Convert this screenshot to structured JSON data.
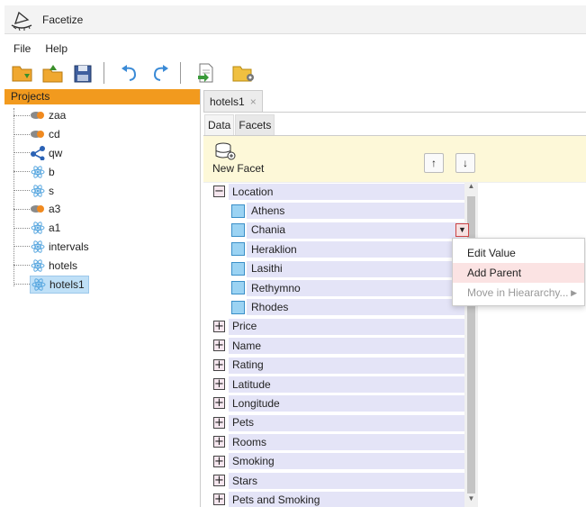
{
  "app": {
    "title": "Facetize"
  },
  "menu": {
    "items": [
      "File",
      "Help"
    ]
  },
  "toolbar": {
    "buttons": [
      "new-project-icon",
      "open-project-icon",
      "save-icon",
      "undo-icon",
      "redo-icon",
      "export-icon",
      "open-folder-icon"
    ]
  },
  "projects": {
    "header": "Projects",
    "items": [
      {
        "label": "zaa",
        "icon": "database-icon"
      },
      {
        "label": "cd",
        "icon": "database-icon"
      },
      {
        "label": "qw",
        "icon": "share-icon"
      },
      {
        "label": "b",
        "icon": "atom-icon"
      },
      {
        "label": "s",
        "icon": "atom-icon"
      },
      {
        "label": "a3",
        "icon": "database-icon"
      },
      {
        "label": "a1",
        "icon": "atom-icon"
      },
      {
        "label": "intervals",
        "icon": "atom-icon"
      },
      {
        "label": "hotels",
        "icon": "atom-icon"
      },
      {
        "label": "hotels1",
        "icon": "atom-icon",
        "selected": true
      }
    ]
  },
  "document_tab": {
    "label": "hotels1",
    "close": "×"
  },
  "sub_tabs": [
    "Data",
    "Facets"
  ],
  "facet_toolbar": {
    "new_facet_label": "New Facet",
    "up": "↑",
    "down": "↓"
  },
  "facets": {
    "location": {
      "label": "Location",
      "expanded": true,
      "values": [
        "Athens",
        "Chania",
        "Heraklion",
        "Lasithi",
        "Rethymno",
        "Rhodes"
      ]
    },
    "collapsed": [
      "Price",
      "Name",
      "Rating",
      "Latitude",
      "Longitude",
      "Pets",
      "Rooms",
      "Smoking",
      "Stars",
      "Pets and Smoking"
    ]
  },
  "context_menu": {
    "items": [
      {
        "label": "Edit Value",
        "state": "normal"
      },
      {
        "label": "Add Parent",
        "state": "hover"
      },
      {
        "label": "Move in Hieararchy...",
        "state": "disabled"
      }
    ]
  },
  "colors": {
    "projects_header": "#f29a1e",
    "facet_toolbar_bg": "#fdf8d8",
    "facet_row_bg": "#e4e4f7",
    "value_box": "#9bd3f3",
    "menu_hover": "#fbe3e3"
  }
}
